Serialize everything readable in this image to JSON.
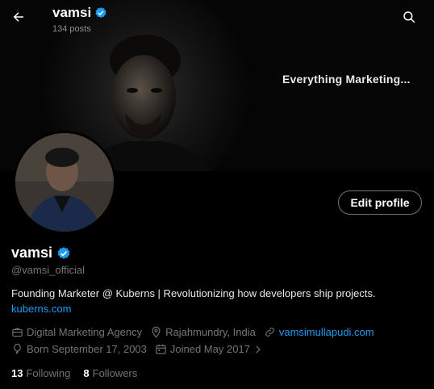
{
  "header": {
    "name": "vamsi",
    "posts_count": "134 posts"
  },
  "banner": {
    "tagline": "Everything Marketing..."
  },
  "profile": {
    "display_name": "vamsi",
    "handle": "@vamsi_official",
    "bio": "Founding Marketer @ Kuberns | Revolutionizing how developers ship projects.",
    "bio_link": "kuberns.com",
    "edit_button": "Edit profile",
    "category": "Digital Marketing Agency",
    "location": "Rajahmundry, India",
    "website": "vamsimullapudi.com",
    "born": "Born September 17, 2003",
    "joined": "Joined May 2017",
    "following_count": "13",
    "following_label": "Following",
    "followers_count": "8",
    "followers_label": "Followers"
  },
  "colors": {
    "background": "#000000",
    "link": "#1d9bf0",
    "verified": "#1d9bf0",
    "muted": "#71767b"
  },
  "icons": [
    "back-arrow-icon",
    "verified-badge-icon",
    "search-icon",
    "briefcase-icon",
    "location-pin-icon",
    "link-icon",
    "balloon-icon",
    "calendar-icon",
    "chevron-right-icon"
  ]
}
